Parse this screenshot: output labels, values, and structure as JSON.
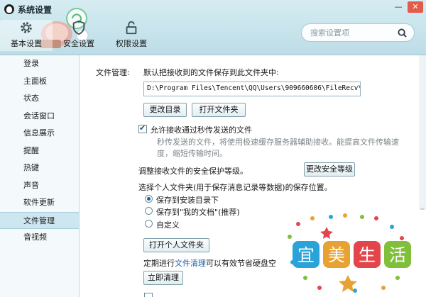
{
  "window": {
    "title": "系统设置",
    "minimize_glyph": "—",
    "close_glyph": "✕"
  },
  "tabs": [
    {
      "label": "基本设置",
      "icon": "gear-icon",
      "active": true
    },
    {
      "label": "安全设置",
      "icon": "shield-icon",
      "active": false
    },
    {
      "label": "权限设置",
      "icon": "lock-icon",
      "active": false
    }
  ],
  "search": {
    "placeholder": "搜索设置项"
  },
  "sidebar": {
    "items": [
      {
        "label": "登录"
      },
      {
        "label": "主面板"
      },
      {
        "label": "状态"
      },
      {
        "label": "会话窗口"
      },
      {
        "label": "信息展示"
      },
      {
        "label": "提醒"
      },
      {
        "label": "热键"
      },
      {
        "label": "声音"
      },
      {
        "label": "软件更新"
      },
      {
        "label": "文件管理",
        "active": true
      },
      {
        "label": "音视频"
      }
    ]
  },
  "file_mgmt": {
    "section_label": "文件管理:",
    "default_save_text": "默认把接收到的文件保存到此文件夹中:",
    "path_value": "D:\\Program Files\\Tencent\\QQ\\Users\\909660606\\FileRecv\\",
    "change_dir_button": "更改目录",
    "open_folder_button": "打开文件夹",
    "allow_quick_label": "允许接收通过秒传发送的文件",
    "allow_quick_checked": true,
    "allow_quick_desc_line1": "秒传发送的文件，将使用极速缓存服务器辅助接收。能提高文件传输速",
    "allow_quick_desc_line2": "度，缩短传输时间。",
    "security_level_text": "调整接收文件的安全保护等级。",
    "change_security_button": "更改安全等级",
    "personal_folder_text": "选择个人文件夹(用于保存消息记录等数据)的保存位置。",
    "radio_install_dir": "保存到安装目录下",
    "radio_my_docs": "保存到\"我的文档\"(推荐)",
    "radio_custom": "自定义",
    "selected_radio": "install_dir",
    "open_personal_button": "打开个人文件夹",
    "cleanup_prefix": "定期进行",
    "cleanup_link": "文件清理",
    "cleanup_suffix": "可以有效节省硬盘空间",
    "cleanup_now_button": "立即清理"
  },
  "watermark": {
    "text": "宜美生活",
    "colors": [
      "#2aa3d8",
      "#e8a233",
      "#e2464b",
      "#7fbf3a"
    ]
  }
}
